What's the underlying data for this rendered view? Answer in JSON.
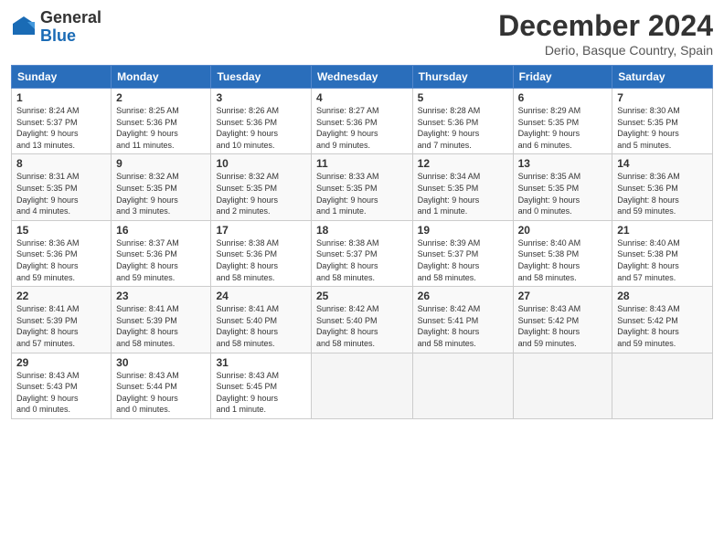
{
  "header": {
    "logo_line1": "General",
    "logo_line2": "Blue",
    "month_title": "December 2024",
    "subtitle": "Derio, Basque Country, Spain"
  },
  "calendar": {
    "headers": [
      "Sunday",
      "Monday",
      "Tuesday",
      "Wednesday",
      "Thursday",
      "Friday",
      "Saturday"
    ],
    "weeks": [
      [
        null,
        null,
        null,
        {
          "day": "4",
          "sunrise": "8:27 AM",
          "sunset": "5:36 PM",
          "daylight": "9 hours and 9 minutes."
        },
        {
          "day": "5",
          "sunrise": "8:28 AM",
          "sunset": "5:36 PM",
          "daylight": "9 hours and 7 minutes."
        },
        {
          "day": "6",
          "sunrise": "8:29 AM",
          "sunset": "5:35 PM",
          "daylight": "9 hours and 6 minutes."
        },
        {
          "day": "7",
          "sunrise": "8:30 AM",
          "sunset": "5:35 PM",
          "daylight": "9 hours and 5 minutes."
        }
      ],
      [
        {
          "day": "1",
          "sunrise": "8:24 AM",
          "sunset": "5:37 PM",
          "daylight": "9 hours and 13 minutes."
        },
        {
          "day": "2",
          "sunrise": "8:25 AM",
          "sunset": "5:36 PM",
          "daylight": "9 hours and 11 minutes."
        },
        {
          "day": "3",
          "sunrise": "8:26 AM",
          "sunset": "5:36 PM",
          "daylight": "9 hours and 10 minutes."
        },
        null,
        null,
        null,
        null
      ],
      [
        {
          "day": "8",
          "sunrise": "8:31 AM",
          "sunset": "5:35 PM",
          "daylight": "9 hours and 4 minutes."
        },
        {
          "day": "9",
          "sunrise": "8:32 AM",
          "sunset": "5:35 PM",
          "daylight": "9 hours and 3 minutes."
        },
        {
          "day": "10",
          "sunrise": "8:32 AM",
          "sunset": "5:35 PM",
          "daylight": "9 hours and 2 minutes."
        },
        {
          "day": "11",
          "sunrise": "8:33 AM",
          "sunset": "5:35 PM",
          "daylight": "9 hours and 1 minute."
        },
        {
          "day": "12",
          "sunrise": "8:34 AM",
          "sunset": "5:35 PM",
          "daylight": "9 hours and 1 minute."
        },
        {
          "day": "13",
          "sunrise": "8:35 AM",
          "sunset": "5:35 PM",
          "daylight": "9 hours and 0 minutes."
        },
        {
          "day": "14",
          "sunrise": "8:36 AM",
          "sunset": "5:36 PM",
          "daylight": "8 hours and 59 minutes."
        }
      ],
      [
        {
          "day": "15",
          "sunrise": "8:36 AM",
          "sunset": "5:36 PM",
          "daylight": "8 hours and 59 minutes."
        },
        {
          "day": "16",
          "sunrise": "8:37 AM",
          "sunset": "5:36 PM",
          "daylight": "8 hours and 59 minutes."
        },
        {
          "day": "17",
          "sunrise": "8:38 AM",
          "sunset": "5:36 PM",
          "daylight": "8 hours and 58 minutes."
        },
        {
          "day": "18",
          "sunrise": "8:38 AM",
          "sunset": "5:37 PM",
          "daylight": "8 hours and 58 minutes."
        },
        {
          "day": "19",
          "sunrise": "8:39 AM",
          "sunset": "5:37 PM",
          "daylight": "8 hours and 58 minutes."
        },
        {
          "day": "20",
          "sunrise": "8:40 AM",
          "sunset": "5:38 PM",
          "daylight": "8 hours and 58 minutes."
        },
        {
          "day": "21",
          "sunrise": "8:40 AM",
          "sunset": "5:38 PM",
          "daylight": "8 hours and 57 minutes."
        }
      ],
      [
        {
          "day": "22",
          "sunrise": "8:41 AM",
          "sunset": "5:39 PM",
          "daylight": "8 hours and 57 minutes."
        },
        {
          "day": "23",
          "sunrise": "8:41 AM",
          "sunset": "5:39 PM",
          "daylight": "8 hours and 58 minutes."
        },
        {
          "day": "24",
          "sunrise": "8:41 AM",
          "sunset": "5:40 PM",
          "daylight": "8 hours and 58 minutes."
        },
        {
          "day": "25",
          "sunrise": "8:42 AM",
          "sunset": "5:40 PM",
          "daylight": "8 hours and 58 minutes."
        },
        {
          "day": "26",
          "sunrise": "8:42 AM",
          "sunset": "5:41 PM",
          "daylight": "8 hours and 58 minutes."
        },
        {
          "day": "27",
          "sunrise": "8:43 AM",
          "sunset": "5:42 PM",
          "daylight": "8 hours and 59 minutes."
        },
        {
          "day": "28",
          "sunrise": "8:43 AM",
          "sunset": "5:42 PM",
          "daylight": "8 hours and 59 minutes."
        }
      ],
      [
        {
          "day": "29",
          "sunrise": "8:43 AM",
          "sunset": "5:43 PM",
          "daylight": "9 hours and 0 minutes."
        },
        {
          "day": "30",
          "sunrise": "8:43 AM",
          "sunset": "5:44 PM",
          "daylight": "9 hours and 0 minutes."
        },
        {
          "day": "31",
          "sunrise": "8:43 AM",
          "sunset": "5:45 PM",
          "daylight": "9 hours and 1 minute."
        },
        null,
        null,
        null,
        null
      ]
    ]
  }
}
